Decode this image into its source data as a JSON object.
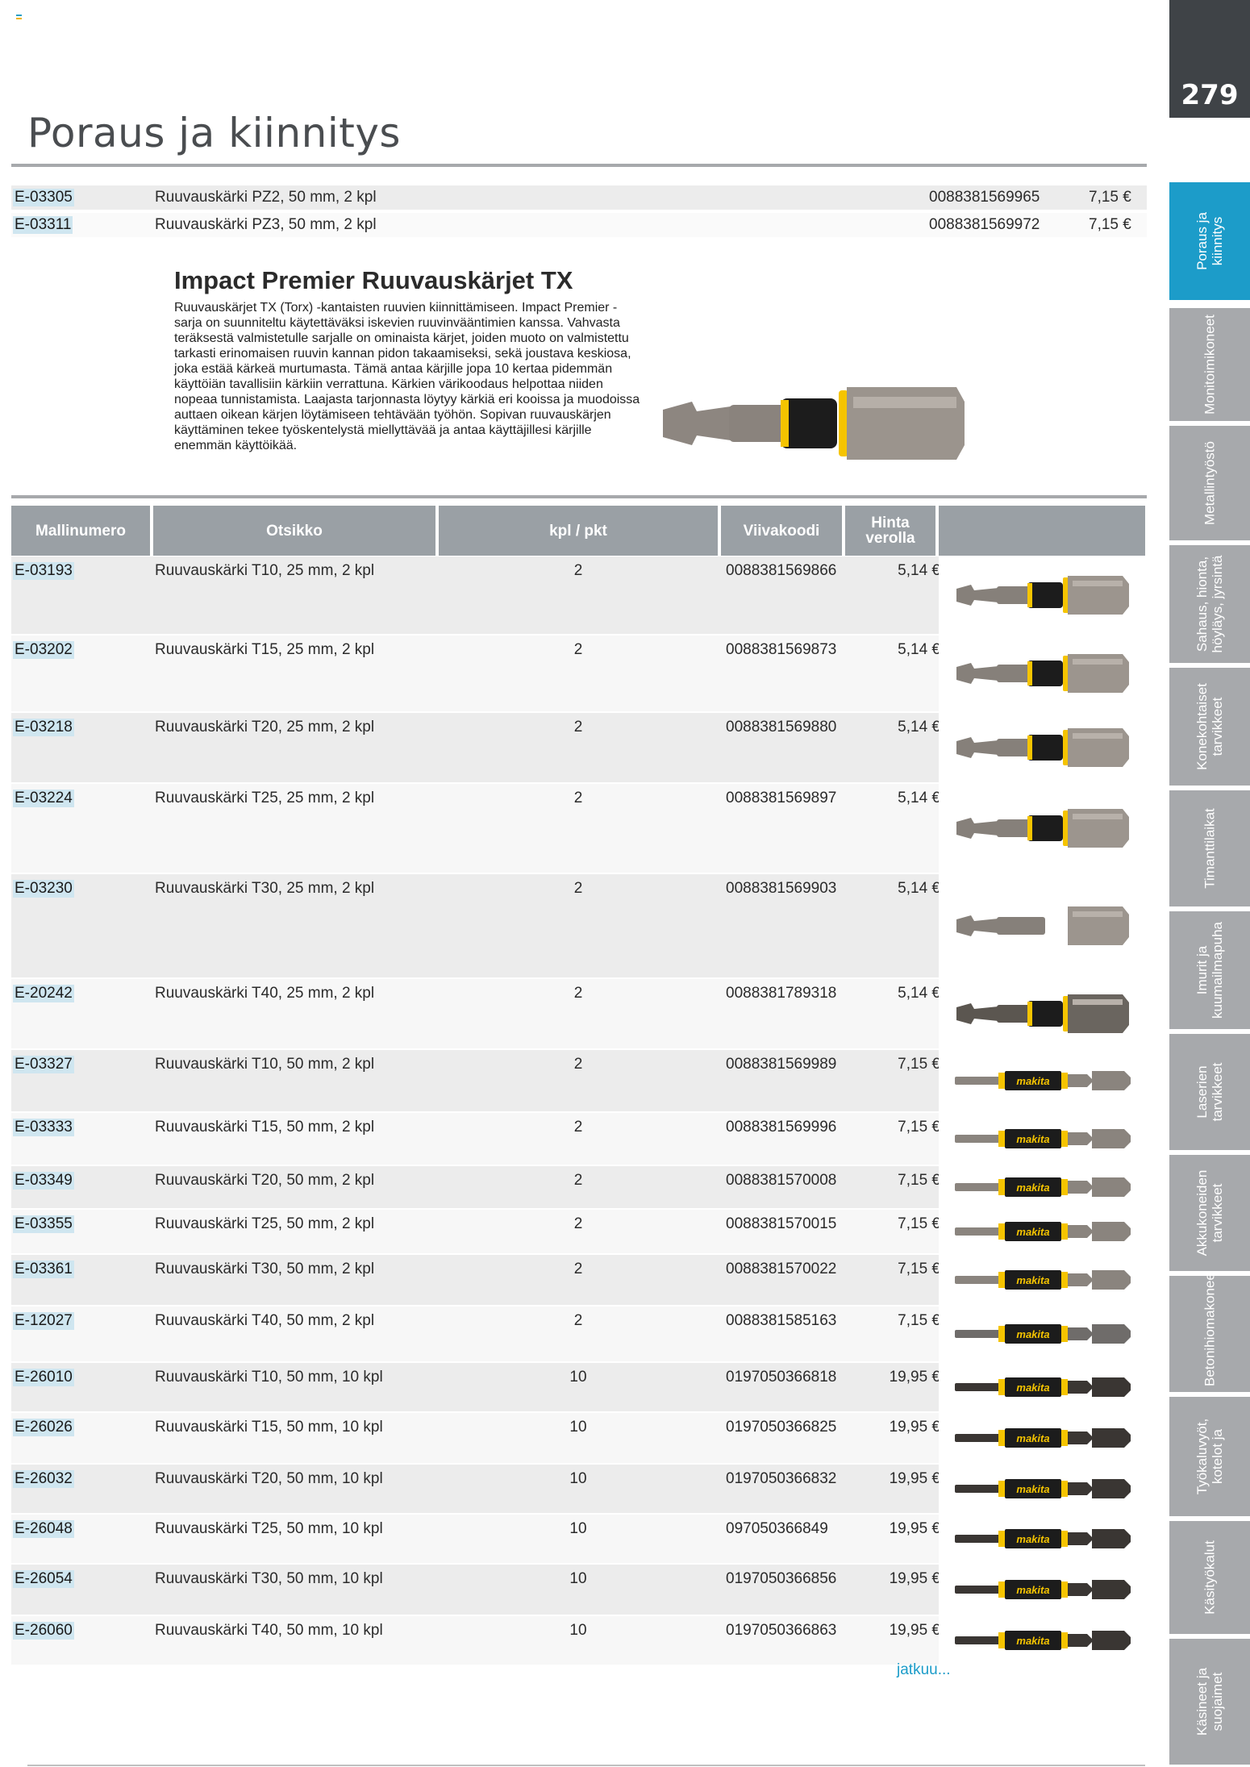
{
  "page": {
    "number": "279",
    "title": "Poraus ja kiinnitys"
  },
  "sidebar": {
    "tabs": [
      {
        "label": "Poraus ja kiinnitys",
        "active": true
      },
      {
        "label": "Monitoimikoneet",
        "active": false
      },
      {
        "label": "Metallintyöstö",
        "active": false
      },
      {
        "label": "Sahaus, hionta, höyläys, jyrsintä",
        "active": false
      },
      {
        "label": "Konekohtaiset tarvikkeet",
        "active": false
      },
      {
        "label": "Timanttilaikat",
        "active": false
      },
      {
        "label": "Imurit ja kuumailmapuha",
        "active": false
      },
      {
        "label": "Laserien tarvikkeet",
        "active": false
      },
      {
        "label": "Akkukoneiden tarvikkeet",
        "active": false
      },
      {
        "label": "Betonihiomakoneet",
        "active": false
      },
      {
        "label": "Työkaluvyöt, kotelot ja",
        "active": false
      },
      {
        "label": "Käsityökalut",
        "active": false
      },
      {
        "label": "Käsineet ja suojaimet",
        "active": false
      }
    ]
  },
  "top_rows": [
    {
      "code": "E-03305",
      "title": "Ruuvauskärki PZ2, 50 mm, 2 kpl",
      "barcode": "0088381569965",
      "price": "7,15 €"
    },
    {
      "code": "E-03311",
      "title": "Ruuvauskärki PZ3, 50 mm, 2 kpl",
      "barcode": "0088381569972",
      "price": "7,15 €"
    }
  ],
  "product": {
    "title": "Impact Premier Ruuvauskärjet TX",
    "description": "Ruuvauskärjet TX (Torx) -kantaisten ruuvien kiinnittämiseen. Impact Premier -sarja on suunniteltu käytettäväksi iskevien ruuvinvääntimien kanssa. Vahvasta teräksestä valmistetulle sarjalle on ominaista kärjet, joiden muoto on valmistettu tarkasti erinomaisen ruuvin kannan pidon takaamiseksi, sekä joustava keskiosa, joka estää kärkeä murtumasta. Tämä antaa kärjille jopa 10 kertaa pidemmän käyttöiän tavallisiin kärkiin verrattuna. Kärkien värikoodaus helpottaa niiden nopeaa tunnistamista. Laajasta tarjonnasta löytyy kärkiä eri kooissa ja muodoissa auttaen oikean kärjen löytämiseen tehtävään työhön. Sopivan ruuvauskärjen käyttäminen tekee työskentelystä miellyttävää ja antaa käyttäjillesi kärjille enemmän käyttöikää."
  },
  "table": {
    "headers": {
      "model": "Mallinumero",
      "title": "Otsikko",
      "qty": "kpl / pkt",
      "barcode": "Viivakoodi",
      "price": "Hinta verolla"
    },
    "rows": [
      {
        "code": "E-03193",
        "title": "Ruuvauskärki T10, 25 mm, 2 kpl",
        "qty": "2",
        "barcode": "0088381569866",
        "price": "5,14 €",
        "bit": "short"
      },
      {
        "code": "E-03202",
        "title": "Ruuvauskärki T15, 25 mm, 2 kpl",
        "qty": "2",
        "barcode": "0088381569873",
        "price": "5,14 €",
        "bit": "short"
      },
      {
        "code": "E-03218",
        "title": "Ruuvauskärki T20, 25 mm, 2 kpl",
        "qty": "2",
        "barcode": "0088381569880",
        "price": "5,14 €",
        "bit": "short"
      },
      {
        "code": "E-03224",
        "title": "Ruuvauskärki T25, 25 mm, 2 kpl",
        "qty": "2",
        "barcode": "0088381569897",
        "price": "5,14 €",
        "bit": "short"
      },
      {
        "code": "E-03230",
        "title": "Ruuvauskärki T30, 25 mm, 2 kpl",
        "qty": "2",
        "barcode": "0088381569903",
        "price": "5,14 €",
        "bit": "short-plain"
      },
      {
        "code": "E-20242",
        "title": "Ruuvauskärki T40, 25 mm, 2 kpl",
        "qty": "2",
        "barcode": "0088381789318",
        "price": "5,14 €",
        "bit": "short-dark"
      },
      {
        "code": "E-03327",
        "title": "Ruuvauskärki T10, 50 mm, 2 kpl",
        "qty": "2",
        "barcode": "0088381569989",
        "price": "7,15 €",
        "bit": "long"
      },
      {
        "code": "E-03333",
        "title": "Ruuvauskärki T15, 50 mm, 2 kpl",
        "qty": "2",
        "barcode": "0088381569996",
        "price": "7,15 €",
        "bit": "long"
      },
      {
        "code": "E-03349",
        "title": "Ruuvauskärki T20, 50 mm, 2 kpl",
        "qty": "2",
        "barcode": "0088381570008",
        "price": "7,15 €",
        "bit": "long"
      },
      {
        "code": "E-03355",
        "title": "Ruuvauskärki T25, 50 mm, 2 kpl",
        "qty": "2",
        "barcode": "0088381570015",
        "price": "7,15 €",
        "bit": "long"
      },
      {
        "code": "E-03361",
        "title": "Ruuvauskärki T30, 50 mm, 2 kpl",
        "qty": "2",
        "barcode": "0088381570022",
        "price": "7,15 €",
        "bit": "long"
      },
      {
        "code": "E-12027",
        "title": "Ruuvauskärki T40, 50 mm, 2 kpl",
        "qty": "2",
        "barcode": "0088381585163",
        "price": "7,15 €",
        "bit": "long-grey"
      },
      {
        "code": "E-26010",
        "title": "Ruuvauskärki T10, 50 mm, 10 kpl",
        "qty": "10",
        "barcode": "0197050366818",
        "price": "19,95 €",
        "bit": "long-dark"
      },
      {
        "code": "E-26026",
        "title": "Ruuvauskärki T15, 50 mm, 10 kpl",
        "qty": "10",
        "barcode": "0197050366825",
        "price": "19,95 €",
        "bit": "long-dark"
      },
      {
        "code": "E-26032",
        "title": "Ruuvauskärki T20, 50 mm, 10 kpl",
        "qty": "10",
        "barcode": "0197050366832",
        "price": "19,95 €",
        "bit": "long-dark"
      },
      {
        "code": "E-26048",
        "title": "Ruuvauskärki T25, 50 mm, 10 kpl",
        "qty": "10",
        "barcode": "097050366849",
        "price": "19,95 €",
        "bit": "long-dark"
      },
      {
        "code": "E-26054",
        "title": "Ruuvauskärki T30, 50 mm, 10 kpl",
        "qty": "10",
        "barcode": "0197050366856",
        "price": "19,95 €",
        "bit": "long-dark"
      },
      {
        "code": "E-26060",
        "title": "Ruuvauskärki T40, 50 mm, 10 kpl",
        "qty": "10",
        "barcode": "0197050366863",
        "price": "19,95 €",
        "bit": "long-dark"
      }
    ]
  },
  "bit_brand": "makita",
  "continue_label": "jatkuu...",
  "colors": {
    "accent": "#1c9cc9",
    "tab_grey": "#a7a9ac",
    "header_grey": "#9aa0a5",
    "code_highlight": "#cfe6f0",
    "bit_yellow": "#f5c400"
  }
}
